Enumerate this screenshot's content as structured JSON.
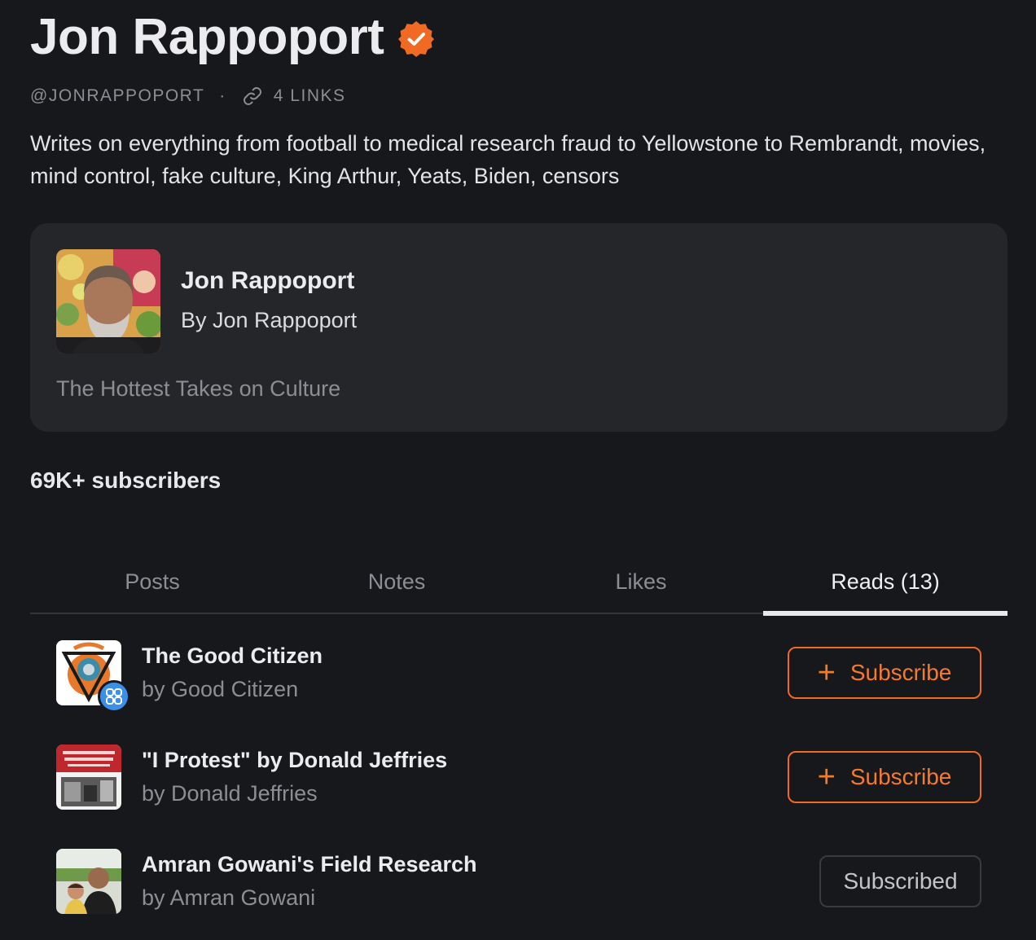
{
  "profile": {
    "name": "Jon Rappoport",
    "handle": "@JONRAPPOPORT",
    "separator": "·",
    "links_label": "4 LINKS",
    "bio": "Writes on everything from football to medical research fraud to Yellowstone to Rembrandt, movies, mind control, fake culture, King Arthur, Yeats, Biden, censors",
    "subscribers": "69K+ subscribers"
  },
  "publication": {
    "title": "Jon Rappoport",
    "author": "By Jon Rappoport",
    "tagline": "The Hottest Takes on Culture"
  },
  "tabs": [
    {
      "label": "Posts",
      "active": false
    },
    {
      "label": "Notes",
      "active": false
    },
    {
      "label": "Likes",
      "active": false
    },
    {
      "label": "Reads (13)",
      "active": true
    }
  ],
  "reads": [
    {
      "title": "The Good Citizen",
      "author": "by Good Citizen",
      "button": "Subscribe",
      "subscribed": false
    },
    {
      "title": "\"I Protest\" by Donald Jeffries",
      "author": "by Donald Jeffries",
      "button": "Subscribe",
      "subscribed": false
    },
    {
      "title": "Amran Gowani's Field Research",
      "author": "by Amran Gowani",
      "button": "Subscribed",
      "subscribed": true
    }
  ],
  "colors": {
    "background": "#17181b",
    "accent": "#f06a24",
    "card": "#252629",
    "badge_blue": "#3c8fe8"
  },
  "icons": {
    "verified": "verified-check-icon",
    "link": "link-icon",
    "plus": "plus-icon",
    "badge": "grid-badge-icon"
  }
}
